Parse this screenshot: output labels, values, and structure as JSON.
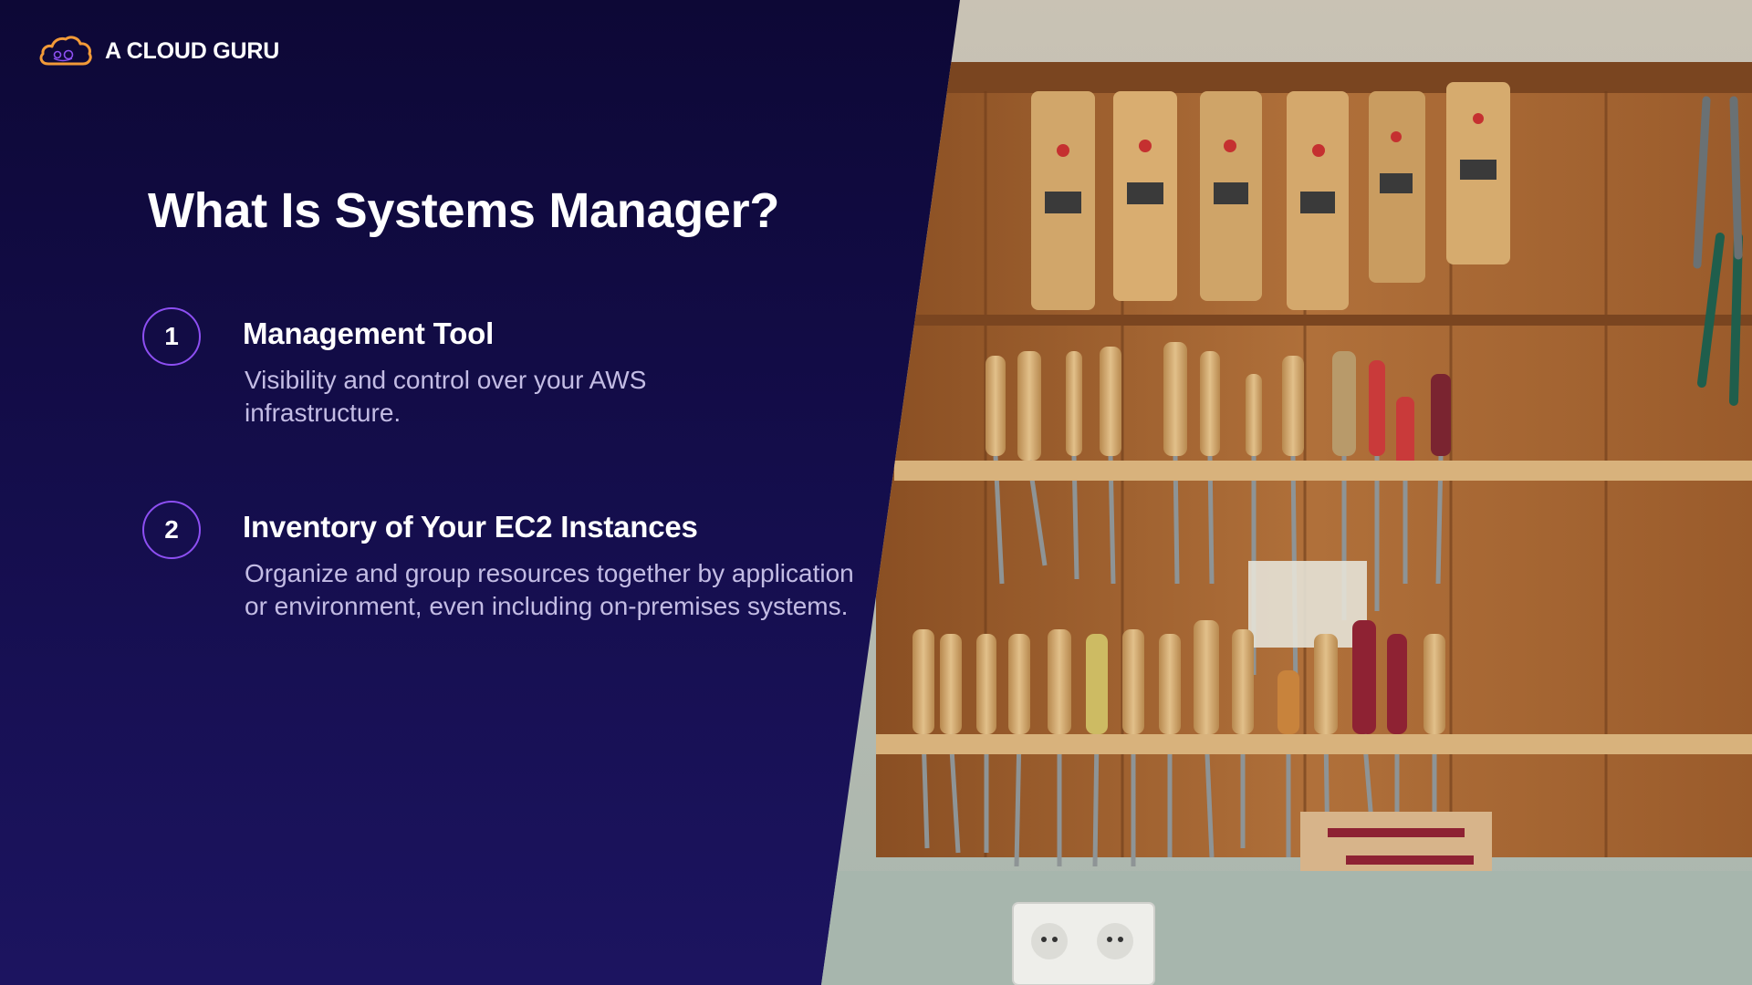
{
  "brand": {
    "name": "A CLOUD GURU",
    "icon": "cloud-logo-icon",
    "accent_color": "#f29a38"
  },
  "title": "What Is Systems Manager?",
  "items": [
    {
      "number": "1",
      "heading": "Management Tool",
      "description": "Visibility and control over your AWS infrastructure."
    },
    {
      "number": "2",
      "heading": "Inventory of Your EC2 Instances",
      "description": "Organize and group resources together by application or environment, even including on-premises systems."
    }
  ],
  "photo": {
    "subject": "woodworking-tools-wall-icon"
  },
  "colors": {
    "background_top": "#0d0836",
    "background_bottom": "#1c1460",
    "number_ring": "#8d4ff2",
    "description_text": "#c3bce4"
  }
}
